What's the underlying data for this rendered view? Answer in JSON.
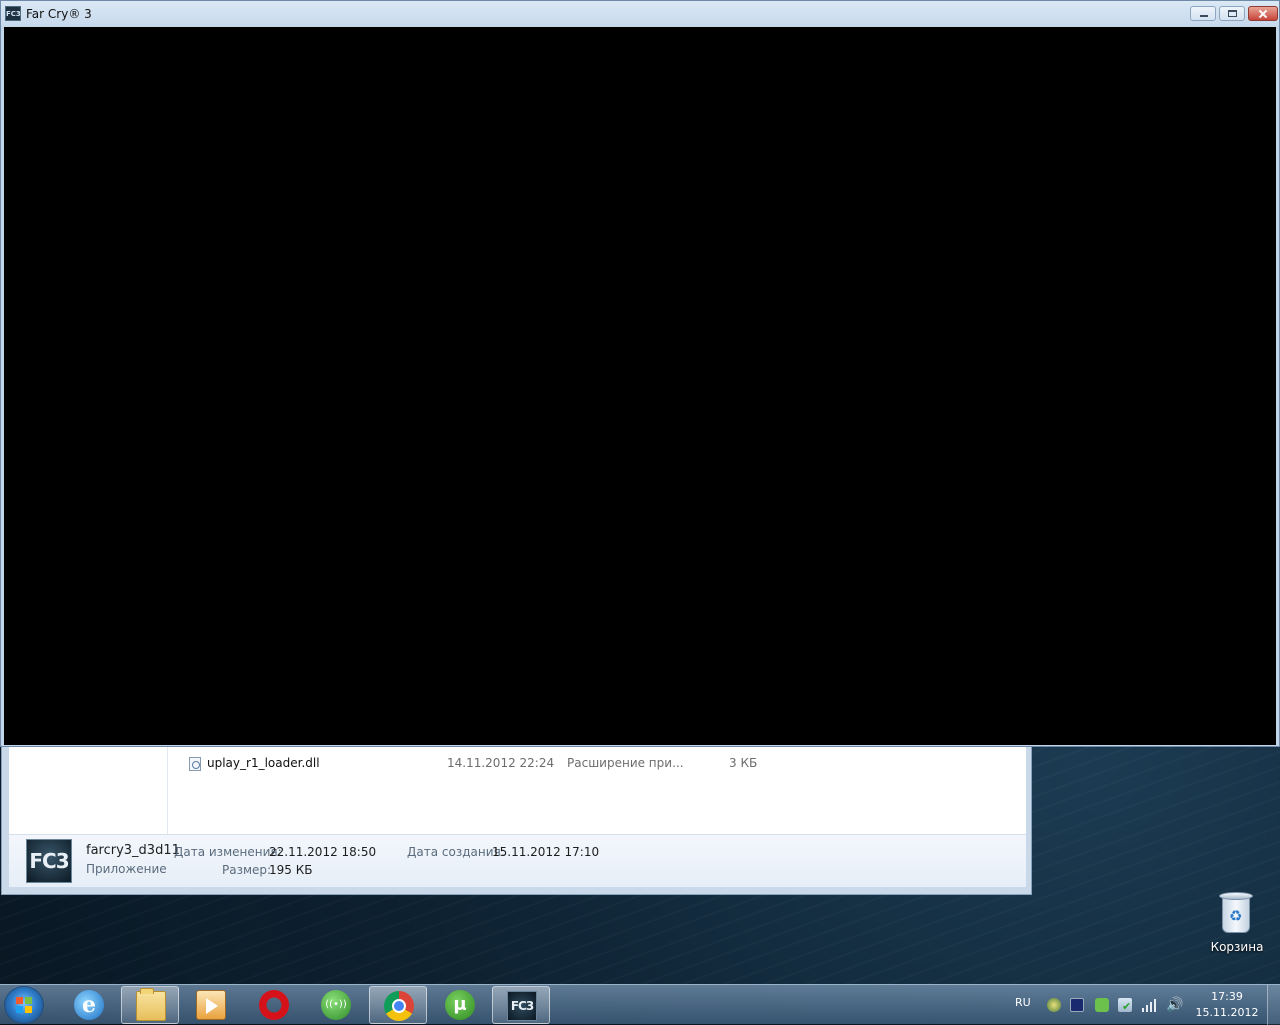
{
  "game_window": {
    "title": "Far Cry® 3",
    "icon_text": "FC3"
  },
  "explorer": {
    "file": {
      "name": "uplay_r1_loader.dll",
      "date": "14.11.2012 22:24",
      "type": "Расширение при...",
      "size": "3 КБ"
    },
    "details": {
      "thumb_text": "FC3",
      "name": "farcry3_d3d11",
      "kind": "Приложение",
      "modified_label": "Дата изменения:",
      "modified_value": "22.11.2012 18:50",
      "created_label": "Дата создания:",
      "created_value": "15.11.2012 17:10",
      "size_label": "Размер:",
      "size_value": "195 КБ"
    }
  },
  "desktop": {
    "recycle_bin_label": "Корзина"
  },
  "taskbar": {
    "pinned": [
      {
        "name": "internet-explorer",
        "glyph": "e"
      },
      {
        "name": "windows-explorer"
      },
      {
        "name": "media-player"
      },
      {
        "name": "opera"
      },
      {
        "name": "network-app",
        "glyph": "((•))"
      },
      {
        "name": "chrome"
      },
      {
        "name": "utorrent",
        "glyph": "μ"
      },
      {
        "name": "far-cry-3",
        "glyph": "FC3"
      }
    ],
    "language": "RU",
    "volume_glyph": "🔊",
    "time": "17:39",
    "date": "15.11.2012"
  }
}
